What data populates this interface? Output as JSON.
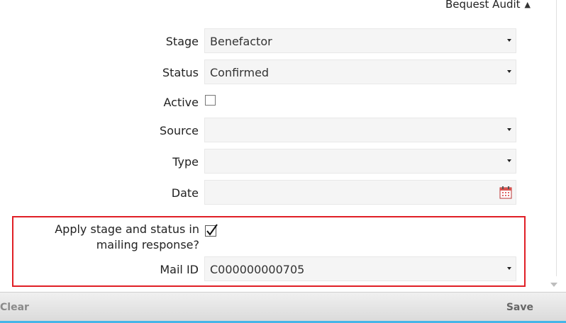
{
  "section": {
    "title": "Bequest Audit",
    "icon": "chevron-up-icon"
  },
  "fields": {
    "stage": {
      "label": "Stage",
      "value": "Benefactor"
    },
    "status": {
      "label": "Status",
      "value": "Confirmed"
    },
    "active": {
      "label": "Active",
      "checked": false
    },
    "source": {
      "label": "Source",
      "value": ""
    },
    "type": {
      "label": "Type",
      "value": ""
    },
    "date": {
      "label": "Date",
      "value": "",
      "icon": "calendar-icon"
    },
    "apply_stage_status": {
      "label": "Apply stage and status in mailing response?",
      "checked": true
    },
    "mail_id": {
      "label": "Mail ID",
      "value": "C000000000705"
    }
  },
  "footer": {
    "clear_label": "Clear",
    "save_label": "Save"
  },
  "colors": {
    "highlight": "#e01f26",
    "accent_edge": "#45b5e8"
  }
}
